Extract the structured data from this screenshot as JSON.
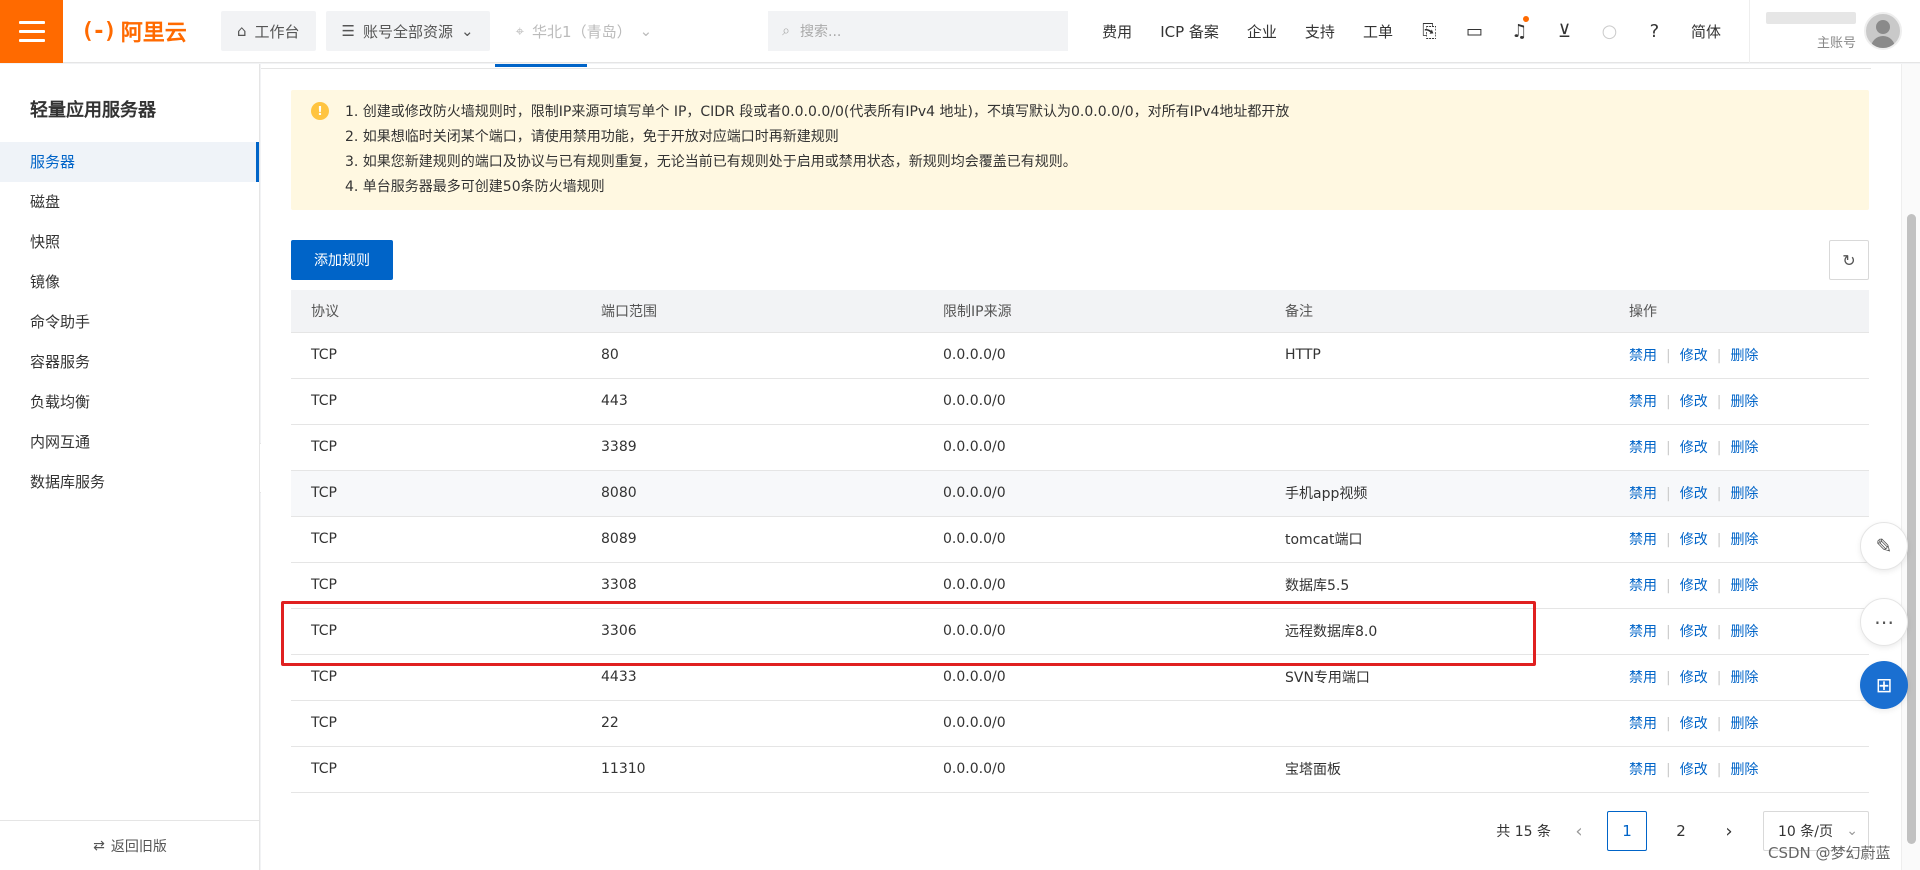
{
  "topbar": {
    "logo_mark": "(-)",
    "logo_text": "阿里云",
    "workbench": "工作台",
    "resources": "账号全部资源",
    "region": "华北1（青岛）",
    "search_placeholder": "搜索...",
    "links": [
      "费用",
      "ICP 备案",
      "企业",
      "支持",
      "工单"
    ],
    "language": "简体",
    "account_role": "主账号",
    "accent_color": "#ff6a00"
  },
  "sidebar": {
    "title": "轻量应用服务器",
    "items": [
      {
        "label": "服务器",
        "active": true
      },
      {
        "label": "磁盘"
      },
      {
        "label": "快照"
      },
      {
        "label": "镜像"
      },
      {
        "label": "命令助手"
      },
      {
        "label": "容器服务"
      },
      {
        "label": "负载均衡"
      },
      {
        "label": "内网互通"
      },
      {
        "label": "数据库服务"
      }
    ],
    "back_label": "返回旧版"
  },
  "notice": {
    "lines": [
      "1. 创建或修改防火墙规则时，限制IP来源可填写单个 IP，CIDR 段或者0.0.0.0/0(代表所有IPv4 地址)，不填写默认为0.0.0.0/0，对所有IPv4地址都开放",
      "2. 如果想临时关闭某个端口，请使用禁用功能，免于开放对应端口时再新建规则",
      "3. 如果您新建规则的端口及协议与已有规则重复，无论当前已有规则处于启用或禁用状态，新规则均会覆盖已有规则。",
      "4. 单台服务器最多可创建50条防火墙规则"
    ]
  },
  "toolbar": {
    "add_rule": "添加规则"
  },
  "table": {
    "headers": [
      "协议",
      "端口范围",
      "限制IP来源",
      "备注",
      "操作"
    ],
    "actions": [
      "禁用",
      "修改",
      "删除"
    ],
    "rows": [
      {
        "protocol": "TCP",
        "port": "80",
        "source": "0.0.0.0/0",
        "note": "HTTP"
      },
      {
        "protocol": "TCP",
        "port": "443",
        "source": "0.0.0.0/0",
        "note": ""
      },
      {
        "protocol": "TCP",
        "port": "3389",
        "source": "0.0.0.0/0",
        "note": ""
      },
      {
        "protocol": "TCP",
        "port": "8080",
        "source": "0.0.0.0/0",
        "note": "手机app视频"
      },
      {
        "protocol": "TCP",
        "port": "8089",
        "source": "0.0.0.0/0",
        "note": "tomcat端口"
      },
      {
        "protocol": "TCP",
        "port": "3308",
        "source": "0.0.0.0/0",
        "note": "数据库5.5"
      },
      {
        "protocol": "TCP",
        "port": "3306",
        "source": "0.0.0.0/0",
        "note": "远程数据库8.0"
      },
      {
        "protocol": "TCP",
        "port": "4433",
        "source": "0.0.0.0/0",
        "note": "SVN专用端口"
      },
      {
        "protocol": "TCP",
        "port": "22",
        "source": "0.0.0.0/0",
        "note": ""
      },
      {
        "protocol": "TCP",
        "port": "11310",
        "source": "0.0.0.0/0",
        "note": "宝塔面板"
      }
    ]
  },
  "pagination": {
    "total": "共 15 条",
    "pages": [
      "1",
      "2"
    ],
    "current_page": "1",
    "page_size": "10 条/页"
  },
  "watermark": "CSDN @梦幻蔚蓝"
}
